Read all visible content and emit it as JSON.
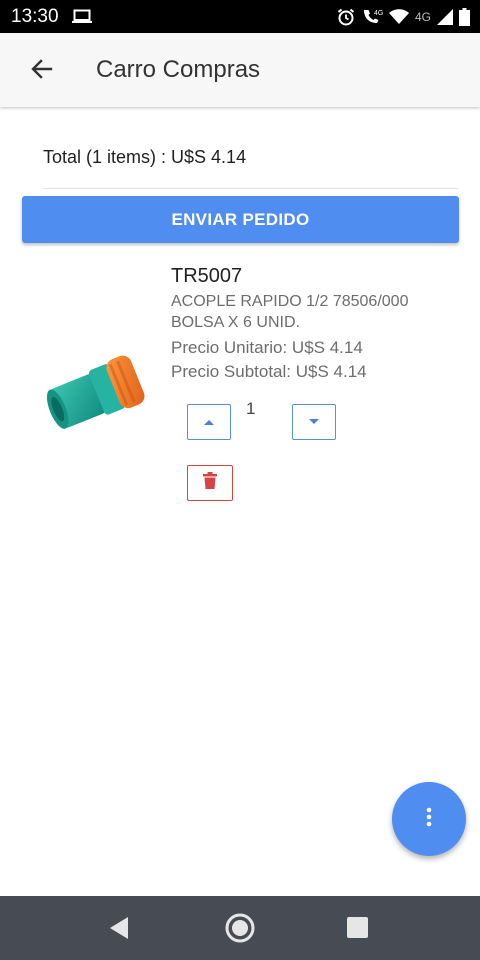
{
  "status_bar": {
    "time": "13:30",
    "network_label": "4G"
  },
  "app_bar": {
    "title": "Carro Compras"
  },
  "cart": {
    "total_text": "Total (1 items) : U$S 4.14",
    "send_button_label": "ENVIAR PEDIDO"
  },
  "items": [
    {
      "code": "TR5007",
      "description": "ACOPLE RAPIDO 1/2 78506/000 BOLSA X 6 UNID.",
      "unit_price": "Precio Unitario: U$S 4.14",
      "subtotal": "Precio Subtotal: U$S 4.14",
      "quantity": "1"
    }
  ],
  "icons": {
    "status": [
      "laptop-icon",
      "alarm-icon",
      "wifi-calling-icon",
      "wifi-icon",
      "signal-icon",
      "battery-icon"
    ],
    "app_bar": "back-arrow-icon",
    "quantity": [
      "chevron-up-icon",
      "chevron-down-icon"
    ],
    "delete": "trash-icon",
    "fab": "more-vertical-icon",
    "navigation": [
      "nav-back-icon",
      "nav-home-icon",
      "nav-recents-icon"
    ]
  },
  "colors": {
    "primary": "#4f8df0",
    "delete": "#d64545",
    "status_bar": "#000000",
    "nav_bar": "#474c54"
  }
}
